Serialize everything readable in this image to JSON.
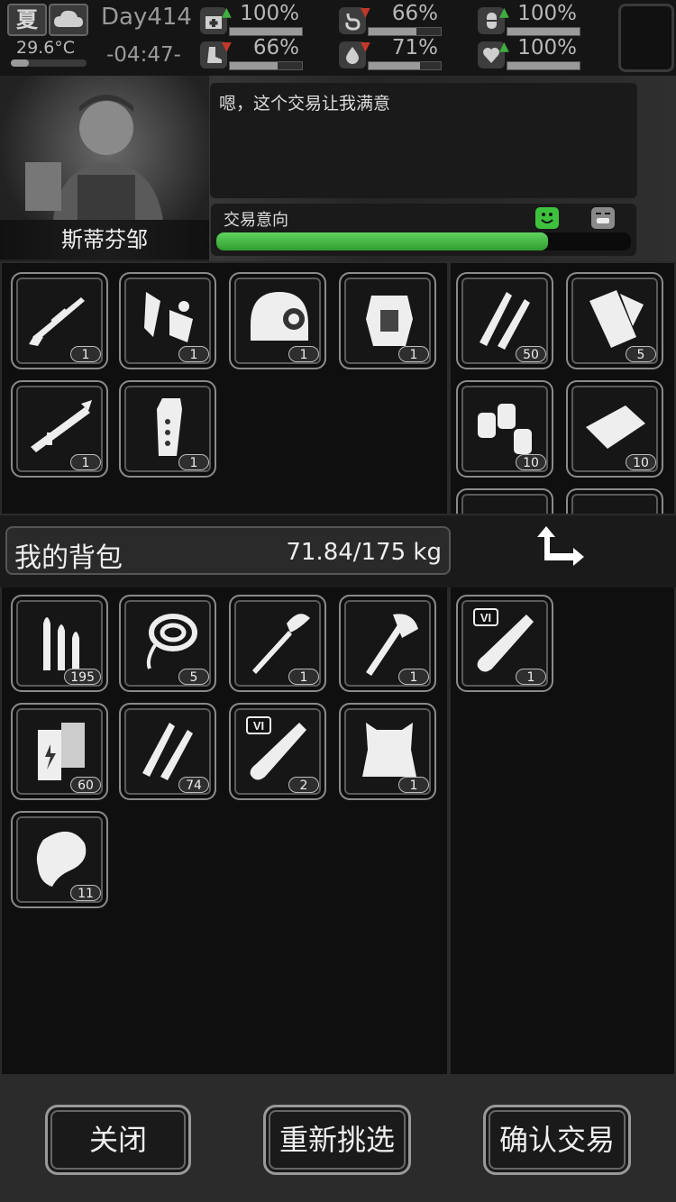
{
  "status": {
    "season": "夏",
    "temperature": "29.6°C",
    "day": "Day414",
    "time": "-04:47-",
    "stats": [
      {
        "name": "health",
        "value": "100%",
        "trend": "up",
        "fill": 1.0
      },
      {
        "name": "hunger",
        "value": "66%",
        "trend": "down",
        "fill": 0.66
      },
      {
        "name": "mood",
        "value": "100%",
        "trend": "up",
        "fill": 1.0
      },
      {
        "name": "stamina",
        "value": "66%",
        "trend": "down",
        "fill": 0.66
      },
      {
        "name": "thirst",
        "value": "71%",
        "trend": "down",
        "fill": 0.71
      },
      {
        "name": "heart",
        "value": "100%",
        "trend": "up",
        "fill": 1.0
      }
    ]
  },
  "trader": {
    "name": "斯蒂芬邹",
    "dialogue": "嗯，这个交易让我满意",
    "intent_label": "交易意向",
    "intent_fill": 0.8
  },
  "trade": {
    "offer_items": [
      {
        "icon": "sniper-rifle-icon",
        "qty": "1"
      },
      {
        "icon": "trap-parts-icon",
        "qty": "1"
      },
      {
        "icon": "combat-helmet-icon",
        "qty": "1"
      },
      {
        "icon": "body-armor-icon",
        "qty": "1"
      },
      {
        "icon": "rocket-launcher-icon",
        "qty": "1"
      },
      {
        "icon": "flashlight-icon",
        "qty": "1"
      }
    ],
    "trader_items": [
      {
        "icon": "rifle-ammo-icon",
        "qty": "50"
      },
      {
        "icon": "bandage-icon",
        "qty": "5"
      },
      {
        "icon": "spray-cans-icon",
        "qty": "10"
      },
      {
        "icon": "bread-icon",
        "qty": "10"
      }
    ]
  },
  "backpack": {
    "title": "我的背包",
    "weight": "71.84/175 kg",
    "items": [
      {
        "icon": "bullets-icon",
        "qty": "195"
      },
      {
        "icon": "rope-icon",
        "qty": "5"
      },
      {
        "icon": "shovel-icon",
        "qty": "1"
      },
      {
        "icon": "axe-icon",
        "qty": "1"
      },
      {
        "icon": "battery-icon",
        "qty": "60"
      },
      {
        "icon": "rifle-ammo-icon",
        "qty": "74"
      },
      {
        "icon": "test-tube-vi-icon",
        "qty": "2"
      },
      {
        "icon": "fur-pelt-icon",
        "qty": "1"
      },
      {
        "icon": "raw-meat-icon",
        "qty": "11"
      }
    ],
    "selected_items": [
      {
        "icon": "test-tube-vi-icon",
        "qty": "1"
      }
    ]
  },
  "footer": {
    "close_label": "关闭",
    "reselect_label": "重新挑选",
    "confirm_label": "确认交易"
  }
}
